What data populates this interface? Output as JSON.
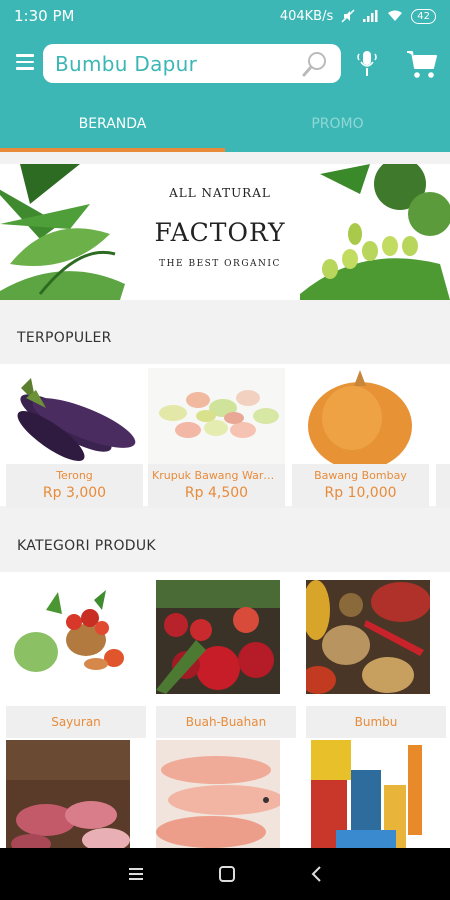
{
  "status_bar": {
    "time": "1:30 PM",
    "net_speed": "404KB/s",
    "battery": "42"
  },
  "search": {
    "value": "Bumbu Dapur"
  },
  "tabs": [
    {
      "label": "BERANDA",
      "active": true
    },
    {
      "label": "PROMO",
      "active": false
    }
  ],
  "banner": {
    "top": "ALL NATURAL",
    "main": "FACTORY",
    "sub": "THE BEST ORGANIC"
  },
  "sections": {
    "popular": "TERPOPULER",
    "categories": "KATEGORI PRODUK"
  },
  "popular": [
    {
      "name": "Terong",
      "price": "Rp 3,000"
    },
    {
      "name": "Krupuk Bawang Warna...",
      "price": "Rp 4,500"
    },
    {
      "name": "Bawang Bombay",
      "price": "Rp 10,000"
    }
  ],
  "categories": [
    {
      "label": "Sayuran"
    },
    {
      "label": "Buah-Buahan"
    },
    {
      "label": "Bumbu"
    },
    {
      "label": ""
    },
    {
      "label": ""
    },
    {
      "label": ""
    }
  ],
  "colors": {
    "primary": "#3cb7b5",
    "accent": "#e88b3a",
    "tab_inactive": "#8fd8d6"
  },
  "icons": [
    "menu-icon",
    "search-icon",
    "mic-icon",
    "cart-icon",
    "nav-recents-icon",
    "nav-home-icon",
    "nav-back-icon"
  ]
}
